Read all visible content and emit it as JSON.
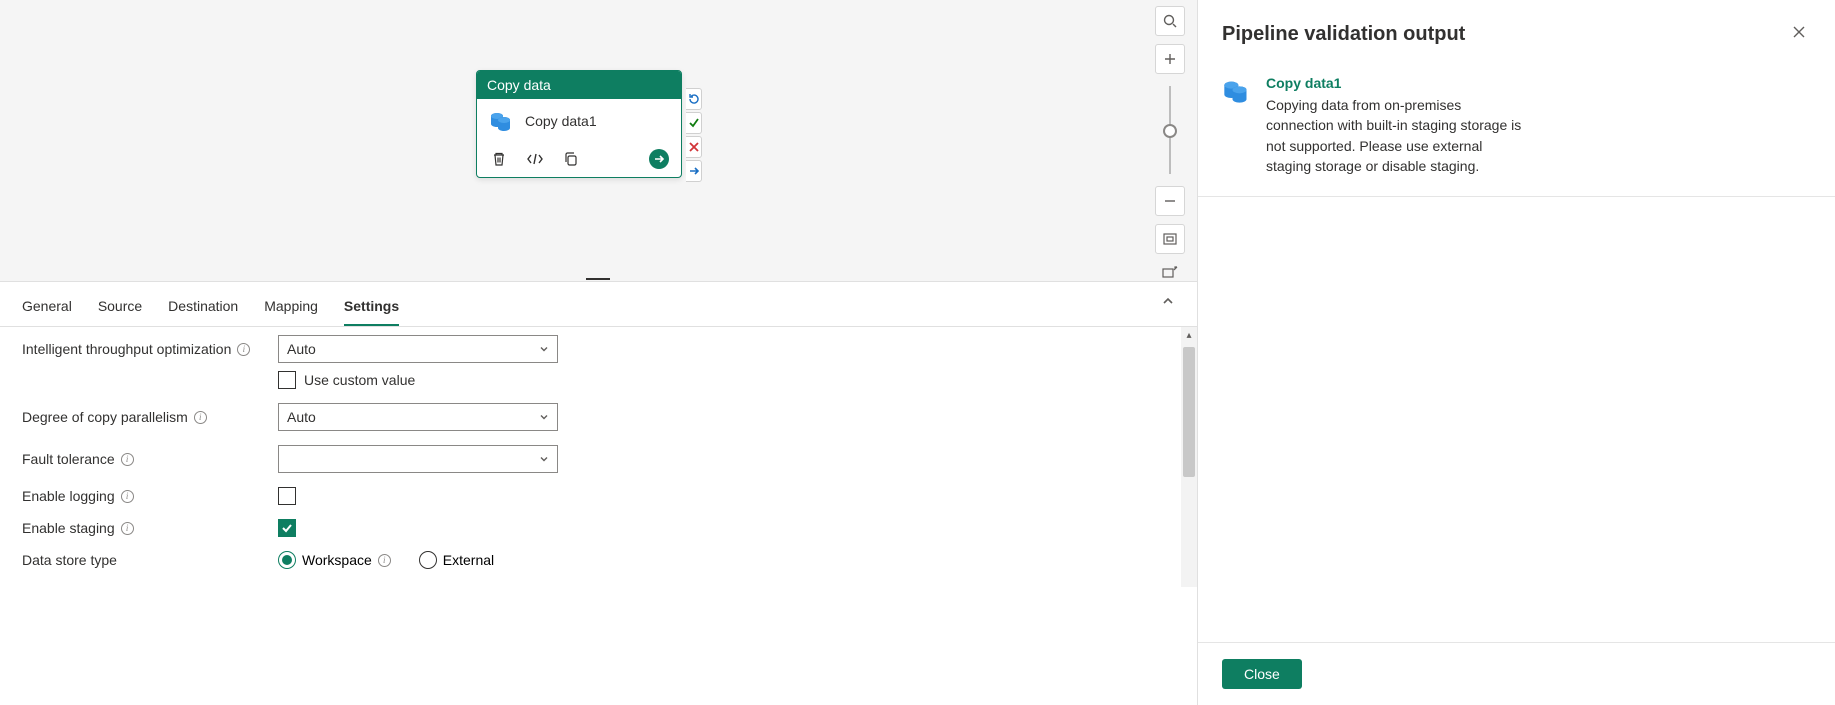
{
  "canvas": {
    "activity_type": "Copy data",
    "activity_name": "Copy data1"
  },
  "tabs": {
    "items": [
      "General",
      "Source",
      "Destination",
      "Mapping",
      "Settings"
    ],
    "active": "Settings"
  },
  "settings": {
    "throughput_label": "Intelligent throughput optimization",
    "throughput_value": "Auto",
    "custom_value_label": "Use custom value",
    "parallelism_label": "Degree of copy parallelism",
    "parallelism_value": "Auto",
    "fault_tolerance_label": "Fault tolerance",
    "fault_tolerance_value": "",
    "enable_logging_label": "Enable logging",
    "enable_staging_label": "Enable staging",
    "data_store_type_label": "Data store type",
    "workspace_label": "Workspace",
    "external_label": "External"
  },
  "validation": {
    "title": "Pipeline validation output",
    "item_title": "Copy data1",
    "item_message": "Copying data from on-premises connection with built-in staging storage is not supported. Please use external staging storage or disable staging.",
    "close_label": "Close"
  }
}
